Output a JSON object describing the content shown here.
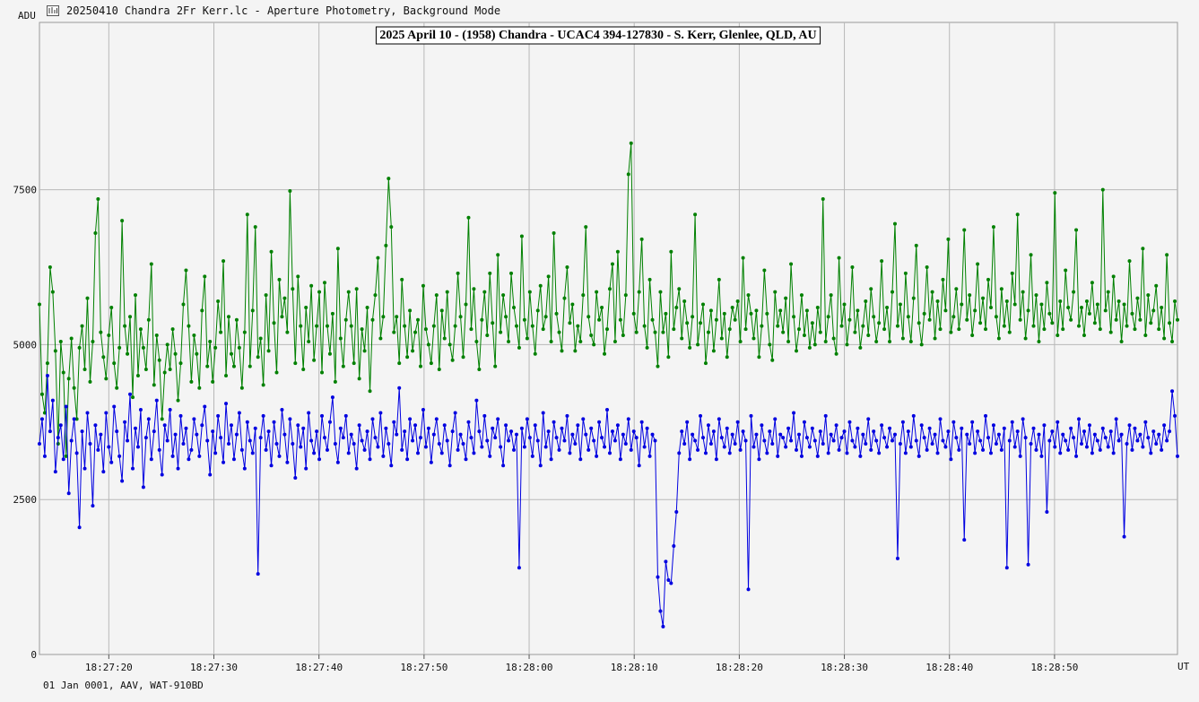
{
  "window": {
    "title": "20250410 Chandra 2Fr Kerr.lc - Aperture Photometry, Background Mode",
    "icon": "lightcurve-icon"
  },
  "footer": {
    "text": "01 Jan 0001, AAV, WAT-910BD"
  },
  "chart_data": {
    "type": "line",
    "title": "2025 April 10 - (1958) Chandra - UCAC4 394-127830 - S. Kerr, Glenlee, QLD, AU",
    "ylabel": "ADU",
    "xlabel": "UT",
    "ylim": [
      0,
      10200
    ],
    "xlim_seconds_of_time": [
      "18:27:13.4",
      "18:29:01.7"
    ],
    "x_ticks": [
      "18:27:20",
      "18:27:30",
      "18:27:40",
      "18:27:50",
      "18:28:00",
      "18:28:10",
      "18:28:20",
      "18:28:30",
      "18:28:40",
      "18:28:50"
    ],
    "y_ticks": [
      0,
      2500,
      5000,
      7500
    ],
    "grid": true,
    "x_sampling": "one point every 0.04 s (2-frame integration, PAL 25 fps)",
    "series": [
      {
        "name": "",
        "color": "#008000",
        "marker": "dot",
        "baseline_mean": 4900,
        "values": [
          5650,
          4200,
          3900,
          4700,
          6250,
          5850,
          4900,
          3400,
          5050,
          4550,
          3200,
          4450,
          5100,
          4300,
          3800,
          4950,
          5300,
          4600,
          5750,
          4400,
          5050,
          6800,
          7350,
          5200,
          4800,
          4450,
          5150,
          5600,
          4700,
          4300,
          4950,
          7000,
          5300,
          4850,
          5450,
          4150,
          5800,
          4500,
          5250,
          4950,
          4600,
          5400,
          6300,
          4350,
          5150,
          4750,
          3800,
          4550,
          5000,
          4600,
          5250,
          4850,
          4100,
          4700,
          5650,
          6200,
          5300,
          4400,
          5150,
          4850,
          4300,
          5550,
          6100,
          4650,
          5050,
          4400,
          4950,
          5700,
          5200,
          6350,
          4500,
          5450,
          4850,
          4650,
          5400,
          4950,
          4300,
          5200,
          7100,
          4650,
          5550,
          6900,
          4800,
          5100,
          4350,
          5800,
          4900,
          6500,
          5350,
          4550,
          6050,
          5450,
          5750,
          5200,
          7480,
          5900,
          4700,
          6100,
          5300,
          4600,
          5600,
          5050,
          5950,
          4750,
          5300,
          5850,
          4550,
          6000,
          5300,
          4850,
          5500,
          4400,
          6550,
          5100,
          4650,
          5400,
          5850,
          5300,
          4700,
          5900,
          4450,
          5250,
          4900,
          5600,
          4250,
          5400,
          5800,
          6400,
          5100,
          5450,
          6600,
          7680,
          6900,
          5200,
          5450,
          4700,
          6050,
          5300,
          4800,
          5550,
          4900,
          5200,
          5400,
          4650,
          5950,
          5250,
          5000,
          4700,
          5300,
          5800,
          4600,
          5550,
          5100,
          5850,
          5000,
          4750,
          5300,
          6150,
          5450,
          4800,
          5650,
          7050,
          5250,
          5900,
          5050,
          4600,
          5400,
          5850,
          5150,
          6150,
          5350,
          4650,
          6450,
          5200,
          5800,
          5450,
          5050,
          6150,
          5600,
          5300,
          4950,
          6750,
          5400,
          5100,
          5850,
          5300,
          4850,
          5550,
          5950,
          5250,
          5450,
          6100,
          5050,
          6800,
          5500,
          5200,
          4900,
          5750,
          6250,
          5350,
          5650,
          4900,
          5300,
          5050,
          5800,
          6900,
          5450,
          5150,
          5000,
          5850,
          5400,
          5600,
          4850,
          5250,
          5900,
          6300,
          5050,
          6500,
          5400,
          5150,
          5800,
          7750,
          8250,
          5500,
          5200,
          5850,
          6700,
          5300,
          4950,
          6050,
          5400,
          5200,
          4650,
          5850,
          5200,
          5500,
          4800,
          6500,
          5250,
          5600,
          5900,
          5100,
          5700,
          5350,
          4950,
          5450,
          7100,
          5000,
          5350,
          5650,
          4700,
          5200,
          5550,
          4900,
          5400,
          6050,
          5100,
          5500,
          4800,
          5250,
          5600,
          5400,
          5700,
          5050,
          6400,
          5250,
          5800,
          5500,
          5100,
          5550,
          4800,
          5300,
          6200,
          5500,
          5000,
          4750,
          5850,
          5300,
          5550,
          5200,
          5750,
          5050,
          6300,
          5450,
          4900,
          5250,
          5800,
          5150,
          5550,
          4950,
          5350,
          5000,
          5600,
          5200,
          7350,
          5050,
          5450,
          5800,
          5100,
          4850,
          6400,
          5300,
          5650,
          5000,
          5400,
          6250,
          5200,
          5550,
          4950,
          5300,
          5700,
          5150,
          5900,
          5450,
          5050,
          5350,
          6350,
          5250,
          5600,
          5050,
          5850,
          6950,
          5300,
          5650,
          5100,
          6150,
          5450,
          5050,
          5750,
          6600,
          5350,
          5000,
          5500,
          6250,
          5400,
          5850,
          5100,
          5700,
          5250,
          6050,
          5550,
          6700,
          5200,
          5450,
          5900,
          5250,
          5650,
          6850,
          5400,
          5800,
          5150,
          5550,
          6300,
          5350,
          5750,
          5250,
          6050,
          5600,
          6900,
          5450,
          5100,
          5900,
          5300,
          5700,
          5200,
          6150,
          5650,
          7100,
          5400,
          5850,
          5100,
          5550,
          6450,
          5300,
          5800,
          5050,
          5650,
          5250,
          6000,
          5500,
          5350,
          7450,
          5150,
          5700,
          5250,
          6200,
          5600,
          5400,
          5850,
          6850,
          5300,
          5600,
          5150,
          5700,
          5500,
          6000,
          5350,
          5650,
          5250,
          7500,
          5550,
          5850,
          5200,
          6100,
          5400,
          5700,
          5050,
          5650,
          5300,
          6350,
          5500,
          5250,
          5750,
          5400,
          6550,
          5150,
          5800,
          5350,
          5550,
          5950,
          5250,
          5600,
          5100,
          6450,
          5350,
          5050,
          5700,
          5400
        ]
      },
      {
        "name": "",
        "color": "#0000e0",
        "marker": "dot",
        "baseline_mean": 3500,
        "values": [
          3400,
          3800,
          3200,
          4500,
          3600,
          4100,
          2950,
          3500,
          3700,
          3150,
          4000,
          2600,
          3450,
          3800,
          3250,
          2050,
          3600,
          3000,
          3900,
          3400,
          2400,
          3700,
          3300,
          3550,
          2950,
          3900,
          3350,
          3100,
          4000,
          3600,
          3200,
          2800,
          3750,
          3450,
          4200,
          3000,
          3650,
          3350,
          3950,
          2700,
          3500,
          3800,
          3150,
          3600,
          4100,
          3300,
          2900,
          3700,
          3450,
          3950,
          3200,
          3550,
          3000,
          3850,
          3400,
          3650,
          3150,
          3300,
          3800,
          3550,
          3200,
          3700,
          4000,
          3450,
          2900,
          3600,
          3250,
          3850,
          3500,
          3100,
          4050,
          3400,
          3700,
          3150,
          3550,
          3900,
          3300,
          3000,
          3750,
          3450,
          3250,
          3650,
          1300,
          3500,
          3850,
          3300,
          3600,
          3050,
          3750,
          3400,
          3200,
          3950,
          3550,
          3100,
          3800,
          3400,
          2850,
          3700,
          3350,
          3650,
          3000,
          3900,
          3450,
          3250,
          3600,
          3150,
          3850,
          3500,
          3300,
          3750,
          4150,
          3400,
          3100,
          3650,
          3500,
          3850,
          3250,
          3550,
          3400,
          3000,
          3700,
          3450,
          3300,
          3600,
          3150,
          3800,
          3500,
          3350,
          3900,
          3200,
          3650,
          3400,
          3050,
          3750,
          3550,
          4300,
          3300,
          3600,
          3150,
          3800,
          3450,
          3700,
          3250,
          3500,
          3950,
          3350,
          3650,
          3100,
          3550,
          3800,
          3400,
          3250,
          3700,
          3450,
          3050,
          3600,
          3900,
          3300,
          3550,
          3400,
          3150,
          3750,
          3500,
          3250,
          4100,
          3600,
          3350,
          3850,
          3450,
          3200,
          3650,
          3500,
          3800,
          3350,
          3050,
          3700,
          3450,
          3600,
          3300,
          3550,
          1400,
          3650,
          3350,
          3800,
          3500,
          3200,
          3700,
          3450,
          3050,
          3900,
          3350,
          3600,
          3150,
          3750,
          3500,
          3300,
          3650,
          3450,
          3850,
          3250,
          3550,
          3400,
          3700,
          3150,
          3800,
          3550,
          3300,
          3650,
          3450,
          3200,
          3750,
          3500,
          3350,
          3950,
          3250,
          3600,
          3450,
          3700,
          3150,
          3550,
          3400,
          3800,
          3300,
          3600,
          3500,
          3050,
          3750,
          3350,
          3650,
          3200,
          3550,
          3450,
          1250,
          700,
          450,
          1500,
          1200,
          1150,
          1750,
          2300,
          3250,
          3600,
          3400,
          3750,
          3150,
          3550,
          3450,
          3300,
          3850,
          3500,
          3250,
          3700,
          3400,
          3600,
          3150,
          3800,
          3500,
          3350,
          3650,
          3250,
          3550,
          3400,
          3750,
          3300,
          3600,
          3450,
          1050,
          3850,
          3350,
          3550,
          3150,
          3700,
          3450,
          3250,
          3600,
          3400,
          3800,
          3200,
          3550,
          3500,
          3350,
          3650,
          3450,
          3900,
          3300,
          3550,
          3200,
          3750,
          3500,
          3350,
          3650,
          3450,
          3200,
          3600,
          3400,
          3850,
          3250,
          3550,
          3450,
          3700,
          3300,
          3500,
          3600,
          3250,
          3750,
          3450,
          3350,
          3650,
          3200,
          3550,
          3400,
          3800,
          3300,
          3600,
          3450,
          3250,
          3700,
          3500,
          3350,
          3650,
          3450,
          3550,
          1550,
          3400,
          3750,
          3250,
          3600,
          3350,
          3850,
          3450,
          3200,
          3700,
          3500,
          3300,
          3650,
          3400,
          3550,
          3250,
          3800,
          3450,
          3350,
          3600,
          3150,
          3750,
          3500,
          3300,
          3650,
          1850,
          3550,
          3400,
          3750,
          3250,
          3600,
          3450,
          3300,
          3850,
          3500,
          3250,
          3700,
          3400,
          3550,
          3300,
          3650,
          1400,
          3450,
          3750,
          3350,
          3600,
          3200,
          3800,
          3500,
          1450,
          3400,
          3650,
          3300,
          3550,
          3200,
          3700,
          2300,
          3450,
          3600,
          3350,
          3750,
          3250,
          3550,
          3450,
          3300,
          3650,
          3500,
          3200,
          3800,
          3400,
          3600,
          3350,
          3700,
          3250,
          3550,
          3450,
          3300,
          3650,
          3500,
          3350,
          3600,
          3250,
          3800,
          3450,
          3550,
          1900,
          3400,
          3700,
          3300,
          3650,
          3450,
          3550,
          3350,
          3750,
          3500,
          3250,
          3600,
          3400,
          3550,
          3300,
          3700,
          3450,
          3600,
          4250,
          3850,
          3200
        ]
      }
    ]
  }
}
